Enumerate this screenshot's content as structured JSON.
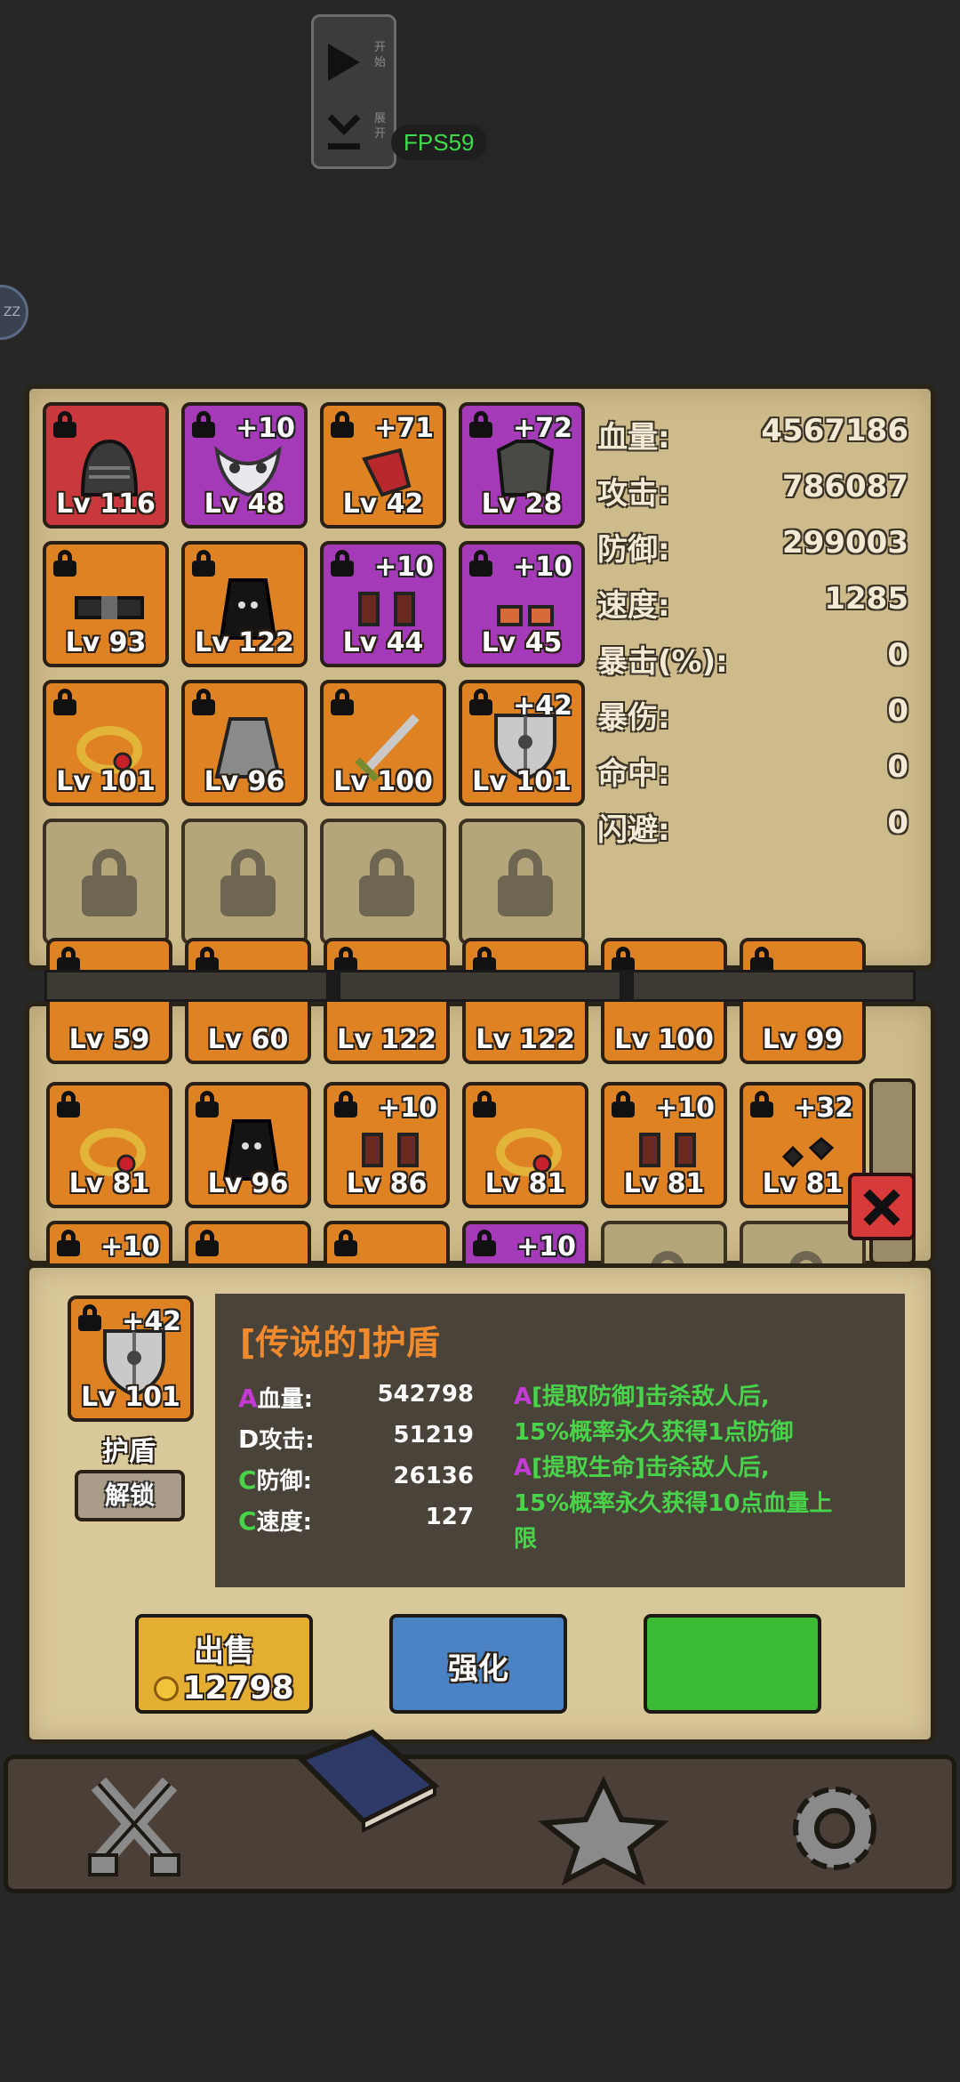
{
  "debug": {
    "play_sub": "开始",
    "download_sub": "展开",
    "fps": "FPS59"
  },
  "side_badge": "ZZ",
  "equipped": [
    {
      "level": "Lv 116",
      "plus": "",
      "rarity": "red",
      "icon": "knight-helmet-icon"
    },
    {
      "level": "Lv 48",
      "plus": "+10",
      "rarity": "purple",
      "icon": "mask-icon"
    },
    {
      "level": "Lv 42",
      "plus": "+71",
      "rarity": "orange",
      "icon": "red-cloth-icon"
    },
    {
      "level": "Lv 28",
      "plus": "+72",
      "rarity": "purple",
      "icon": "armor-icon"
    },
    {
      "level": "Lv 93",
      "plus": "",
      "rarity": "orange",
      "icon": "belt-icon"
    },
    {
      "level": "Lv 122",
      "plus": "",
      "rarity": "orange",
      "icon": "dark-cloak-icon"
    },
    {
      "level": "Lv 44",
      "plus": "+10",
      "rarity": "purple",
      "icon": "boots-icon"
    },
    {
      "level": "Lv 45",
      "plus": "+10",
      "rarity": "purple",
      "icon": "gloves-icon"
    },
    {
      "level": "Lv 101",
      "plus": "",
      "rarity": "orange",
      "icon": "ring-icon"
    },
    {
      "level": "Lv 96",
      "plus": "",
      "rarity": "orange",
      "icon": "skirt-icon"
    },
    {
      "level": "Lv 100",
      "plus": "",
      "rarity": "orange",
      "icon": "sword-icon"
    },
    {
      "level": "Lv 101",
      "plus": "+42",
      "rarity": "orange",
      "icon": "shield-icon"
    }
  ],
  "stats": [
    {
      "label": "血量:",
      "value": "4567186"
    },
    {
      "label": "攻击:",
      "value": "786087"
    },
    {
      "label": "防御:",
      "value": "299003"
    },
    {
      "label": "速度:",
      "value": "1285"
    },
    {
      "label": "暴击(%):",
      "value": "0"
    },
    {
      "label": "暴伤:",
      "value": "0"
    },
    {
      "label": "命中:",
      "value": "0"
    },
    {
      "label": "闪避:",
      "value": "0"
    }
  ],
  "inventory_row1": [
    "Lv 59",
    "Lv 60",
    "Lv 122",
    "Lv 122",
    "Lv 100",
    "Lv 99"
  ],
  "inventory_row2": [
    {
      "level": "Lv 81",
      "plus": "",
      "icon": "ring-icon"
    },
    {
      "level": "Lv 96",
      "plus": "",
      "icon": "dark-cloak-icon"
    },
    {
      "level": "Lv 86",
      "plus": "+10",
      "icon": "boots-icon"
    },
    {
      "level": "Lv 81",
      "plus": "",
      "icon": "ring-icon"
    },
    {
      "level": "Lv 81",
      "plus": "+10",
      "icon": "boots-icon"
    },
    {
      "level": "Lv 81",
      "plus": "+32",
      "icon": "gems-icon"
    }
  ],
  "inventory_row3_plus": [
    "+10",
    "+10"
  ],
  "selected": {
    "level": "Lv 101",
    "plus": "+42",
    "name": "护盾",
    "unlock_label": "解锁",
    "title": "[传说的]护盾",
    "attrs": [
      {
        "grade": "A",
        "label": "血量:",
        "value": "542798",
        "color": "#c33ad4"
      },
      {
        "grade": "D",
        "label": "攻击:",
        "value": "51219",
        "color": "#ffffff"
      },
      {
        "grade": "C",
        "label": "防御:",
        "value": "26136",
        "color": "#49d34a"
      },
      {
        "grade": "C",
        "label": "速度:",
        "value": "127",
        "color": "#49d34a"
      }
    ],
    "affix1_grade": "A",
    "affix1_head": "[提取防御]击杀敌人后,",
    "affix1_body": "15%概率永久获得1点防御",
    "affix2_grade": "A",
    "affix2_head": "[提取生命]击杀敌人后,",
    "affix2_body1": "15%概率永久获得10点血量上",
    "affix2_body2": "限"
  },
  "actions": {
    "sell_label": "出售",
    "sell_price": "12798",
    "upgrade_label": "强化",
    "third_label": ""
  },
  "nav": [
    "battle-icon",
    "book-icon",
    "star-icon",
    "settings-gear-icon"
  ],
  "colors": {
    "legendary": "#de8224",
    "epic": "#a43ab8",
    "mythic": "#c8383c",
    "fps": "#3fdc4a"
  }
}
